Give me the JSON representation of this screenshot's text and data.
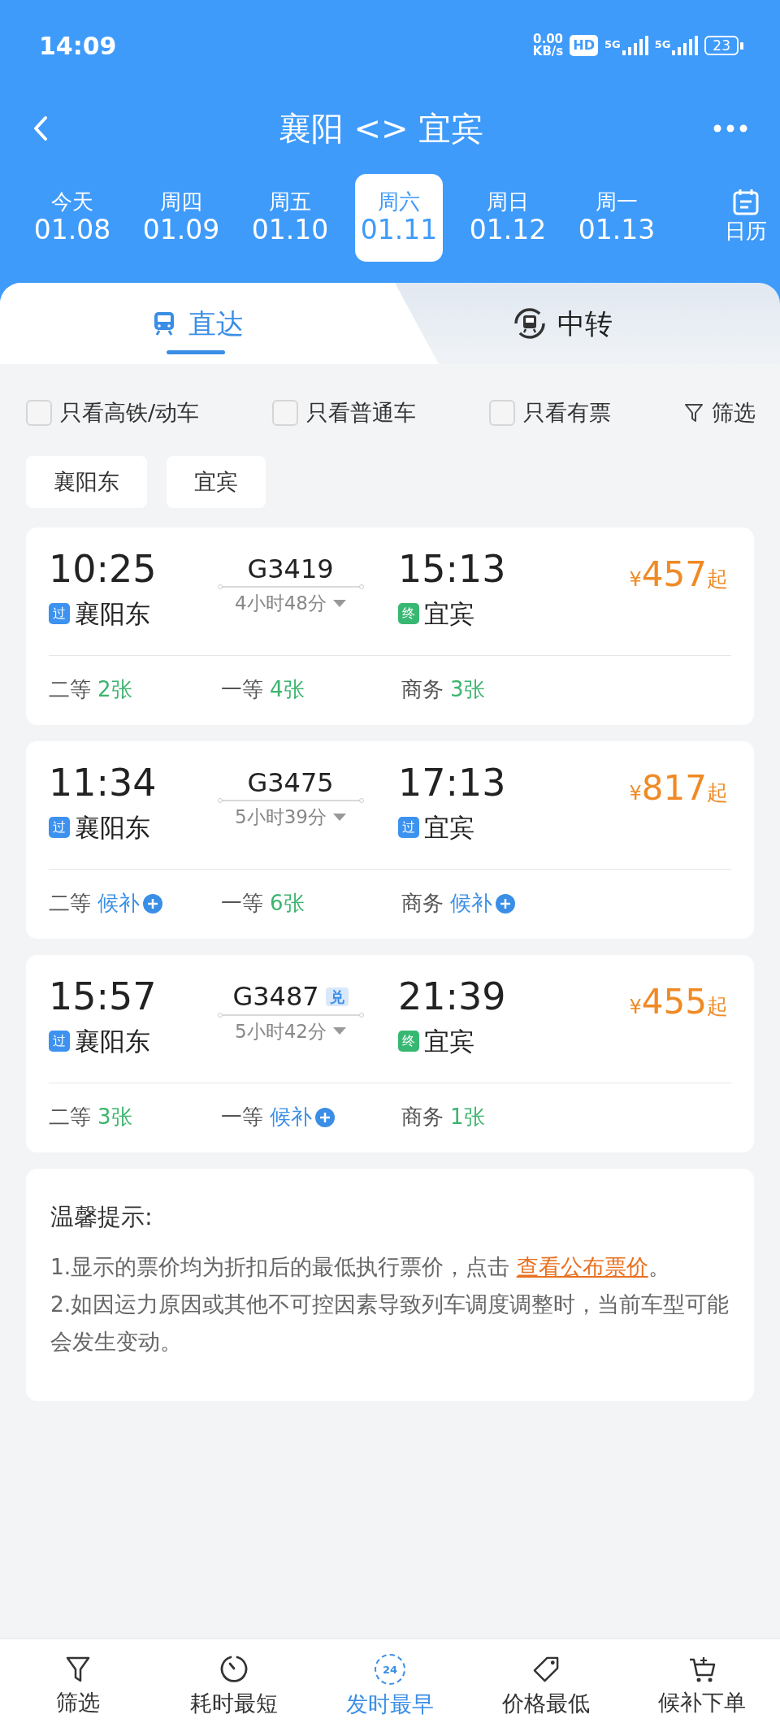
{
  "status_bar": {
    "time": "14:09",
    "net_speed": [
      "0.00",
      "KB/s"
    ],
    "hd_badge": "HD",
    "networks": [
      "5G",
      "5G"
    ],
    "battery": "23"
  },
  "header": {
    "title": "襄阳 <> 宜宾"
  },
  "dates": [
    {
      "weekday": "今天",
      "date": "01.08",
      "selected": false
    },
    {
      "weekday": "周四",
      "date": "01.09",
      "selected": false
    },
    {
      "weekday": "周五",
      "date": "01.10",
      "selected": false
    },
    {
      "weekday": "周六",
      "date": "01.11",
      "selected": true
    },
    {
      "weekday": "周日",
      "date": "01.12",
      "selected": false
    },
    {
      "weekday": "周一",
      "date": "01.13",
      "selected": false
    }
  ],
  "calendar_label": "日历",
  "tabs": [
    {
      "label": "直达",
      "kind": "direct",
      "selected": true
    },
    {
      "label": "中转",
      "kind": "transfer",
      "selected": false
    }
  ],
  "filters": [
    {
      "label": "只看高铁/动车",
      "kind": "checkbox",
      "checked": false
    },
    {
      "label": "只看普通车",
      "kind": "checkbox",
      "checked": false
    },
    {
      "label": "只看有票",
      "kind": "checkbox",
      "checked": false
    },
    {
      "label": "筛选",
      "kind": "filter"
    }
  ],
  "stations": [
    "襄阳东",
    "宜宾"
  ],
  "trains": [
    {
      "depart": "10:25",
      "from_badge": {
        "text": "过",
        "kind": "pass"
      },
      "from": "襄阳东",
      "train_no": "G3419",
      "duration": "4小时48分",
      "arrive": "15:13",
      "to_badge": {
        "text": "终",
        "kind": "terminal"
      },
      "to": "宜宾",
      "currency": "¥",
      "price": "457",
      "price_suffix": "起",
      "seats": [
        {
          "class": "二等",
          "availability": "2张",
          "kind": "tickets"
        },
        {
          "class": "一等",
          "availability": "4张",
          "kind": "tickets"
        },
        {
          "class": "商务",
          "availability": "3张",
          "kind": "tickets"
        }
      ]
    },
    {
      "depart": "11:34",
      "from_badge": {
        "text": "过",
        "kind": "pass"
      },
      "from": "襄阳东",
      "train_no": "G3475",
      "duration": "5小时39分",
      "arrive": "17:13",
      "to_badge": {
        "text": "过",
        "kind": "pass"
      },
      "to": "宜宾",
      "currency": "¥",
      "price": "817",
      "price_suffix": "起",
      "seats": [
        {
          "class": "二等",
          "availability": "候补",
          "kind": "waitlist"
        },
        {
          "class": "一等",
          "availability": "6张",
          "kind": "tickets"
        },
        {
          "class": "商务",
          "availability": "候补",
          "kind": "waitlist"
        }
      ]
    },
    {
      "depart": "15:57",
      "from_badge": {
        "text": "过",
        "kind": "pass"
      },
      "from": "襄阳东",
      "train_no": "G3487",
      "tag": "兑",
      "duration": "5小时42分",
      "arrive": "21:39",
      "to_badge": {
        "text": "终",
        "kind": "terminal"
      },
      "to": "宜宾",
      "currency": "¥",
      "price": "455",
      "price_suffix": "起",
      "seats": [
        {
          "class": "二等",
          "availability": "3张",
          "kind": "tickets"
        },
        {
          "class": "一等",
          "availability": "候补",
          "kind": "waitlist"
        },
        {
          "class": "商务",
          "availability": "1张",
          "kind": "tickets"
        }
      ]
    }
  ],
  "tips": {
    "title": "温馨提示:",
    "lines": [
      {
        "text": "1.显示的票价均为折扣后的最低执行票价，点击 ",
        "link": "查看公布票价",
        "after": "。"
      },
      {
        "text": "2.如因运力原因或其他不可控因素导致列车调度调整时，当前车型可能会发生变动。"
      }
    ]
  },
  "bottom_nav": [
    {
      "label": "筛选",
      "kind": "filter",
      "selected": false
    },
    {
      "label": "耗时最短",
      "kind": "timer",
      "selected": false
    },
    {
      "label": "发时最早",
      "kind": "clock24",
      "icon_text": "24",
      "selected": true
    },
    {
      "label": "价格最低",
      "kind": "tag",
      "selected": false
    },
    {
      "label": "候补下单",
      "kind": "cart",
      "selected": false
    }
  ]
}
